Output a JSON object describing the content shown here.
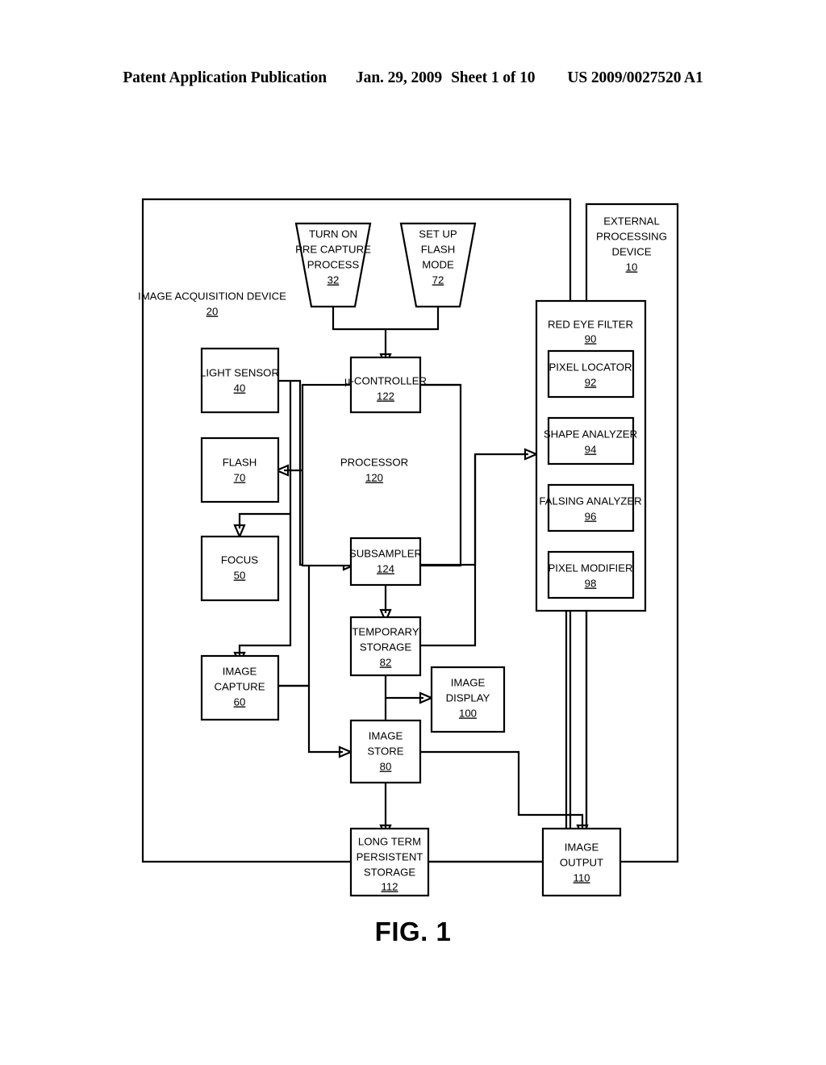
{
  "header": {
    "publication": "Patent Application Publication",
    "date": "Jan. 29, 2009",
    "sheet": "Sheet 1 of 10",
    "number": "US 2009/0027520 A1"
  },
  "figure": {
    "caption": "FIG. 1"
  },
  "diagram": {
    "outer_labels": {
      "acquisition_device": {
        "l1": "IMAGE ACQUISITION DEVICE",
        "num": "20"
      },
      "external_device": {
        "l1": "EXTERNAL",
        "l2": "PROCESSING",
        "l3": "DEVICE",
        "num": "10"
      }
    },
    "trapezoids": [
      {
        "id": "pre-capture",
        "l1": "TURN ON",
        "l2": "PRE CAPTURE",
        "l3": "PROCESS",
        "num": "32"
      },
      {
        "id": "flash-mode",
        "l1": "SET UP",
        "l2": "FLASH",
        "l3": "MODE",
        "num": "72"
      }
    ],
    "blocks": [
      {
        "id": "light-sensor",
        "l1": "LIGHT SENSOR",
        "num": "40"
      },
      {
        "id": "flash",
        "l1": "FLASH",
        "num": "70"
      },
      {
        "id": "focus",
        "l1": "FOCUS",
        "num": "50"
      },
      {
        "id": "image-capture",
        "l1": "IMAGE",
        "l2": "CAPTURE",
        "num": "60"
      },
      {
        "id": "processor",
        "l1": "PROCESSOR",
        "num": "120"
      },
      {
        "id": "micro-controller",
        "l1": "µ-CONTROLLER",
        "num": "122"
      },
      {
        "id": "subsampler",
        "l1": "SUBSAMPLER",
        "num": "124"
      },
      {
        "id": "temporary-storage",
        "l1": "TEMPORARY",
        "l2": "STORAGE",
        "num": "82"
      },
      {
        "id": "image-store",
        "l1": "IMAGE",
        "l2": "STORE",
        "num": "80"
      },
      {
        "id": "image-display",
        "l1": "IMAGE",
        "l2": "DISPLAY",
        "num": "100"
      },
      {
        "id": "long-term-storage",
        "l1": "LONG TERM",
        "l2": "PERSISTENT",
        "l3": "STORAGE",
        "num": "112"
      },
      {
        "id": "image-output",
        "l1": "IMAGE",
        "l2": "OUTPUT",
        "num": "110"
      },
      {
        "id": "red-eye-filter",
        "l1": "RED EYE FILTER",
        "num": "90"
      },
      {
        "id": "pixel-locator",
        "l1": "PIXEL LOCATOR",
        "num": "92"
      },
      {
        "id": "shape-analyzer",
        "l1": "SHAPE ANALYZER",
        "num": "94"
      },
      {
        "id": "falsing-analyzer",
        "l1": "FALSING ANALYZER",
        "num": "96"
      },
      {
        "id": "pixel-modifier",
        "l1": "PIXEL MODIFIER",
        "num": "98"
      }
    ]
  }
}
